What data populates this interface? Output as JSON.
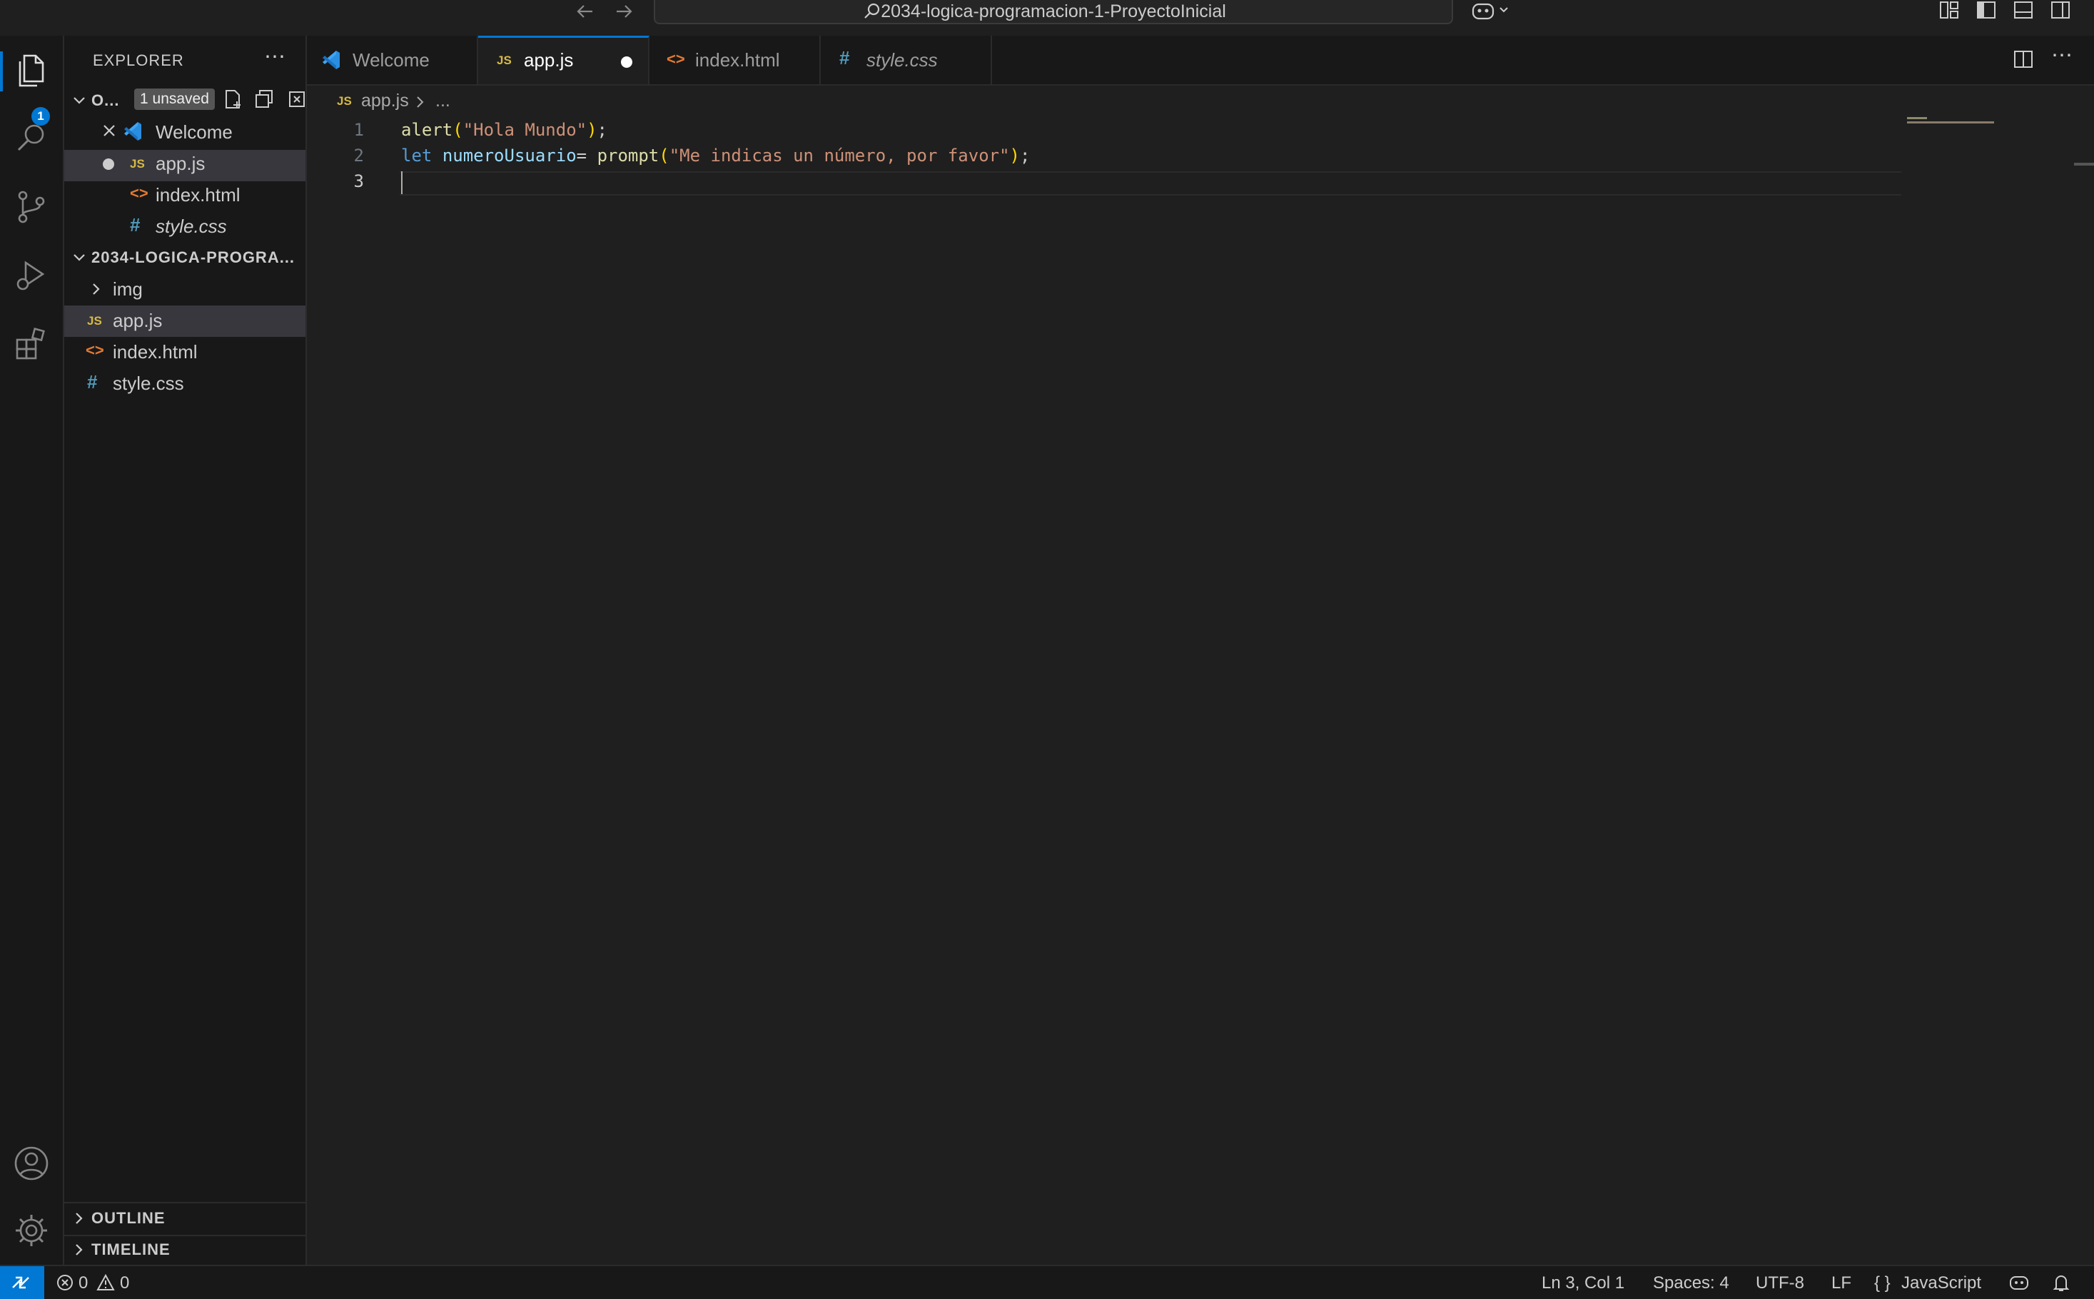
{
  "window": {
    "title": "2034-logica-programacion-1-ProyectoInicial"
  },
  "activity_bar": {
    "explorer_badge": "1",
    "items": [
      "explorer",
      "search",
      "source-control",
      "run-debug",
      "extensions"
    ],
    "bottom": [
      "accounts",
      "manage"
    ]
  },
  "sidebar": {
    "title": "EXPLORER",
    "open_editors": {
      "label": "O...",
      "unsaved_badge": "1 unsaved",
      "items": [
        {
          "label": "Welcome"
        },
        {
          "label": "app.js"
        },
        {
          "label": "index.html"
        },
        {
          "label": "style.css"
        }
      ]
    },
    "folder": {
      "label": "2034-LOGICA-PROGRA...",
      "items": [
        {
          "label": "img"
        },
        {
          "label": "app.js"
        },
        {
          "label": "index.html"
        },
        {
          "label": "style.css"
        }
      ]
    },
    "outline_label": "OUTLINE",
    "timeline_label": "TIMELINE"
  },
  "tabs": [
    {
      "label": "Welcome"
    },
    {
      "label": "app.js"
    },
    {
      "label": "index.html"
    },
    {
      "label": "style.css"
    }
  ],
  "breadcrumb": {
    "file": "app.js",
    "more": "..."
  },
  "editor": {
    "line_numbers": [
      "1",
      "2",
      "3"
    ],
    "lines": [
      {
        "fn": "alert",
        "open": "(",
        "str": "\"Hola Mundo\"",
        "close": ")",
        "end": ";"
      },
      {
        "kw": "let",
        "var": "numeroUsuario",
        "eq": "= ",
        "fn": "prompt",
        "open": "(",
        "str": "\"Me indicas un número, por favor\"",
        "close": ")",
        "end": ";"
      }
    ]
  },
  "status_bar": {
    "errors": "0",
    "warnings": "0",
    "position": "Ln 3, Col 1",
    "spaces": "Spaces: 4",
    "encoding": "UTF-8",
    "eol": "LF",
    "language": "JavaScript"
  },
  "colors": {
    "accent": "#0078d4",
    "background": "#1f1f1f",
    "sidebar": "#181818"
  }
}
